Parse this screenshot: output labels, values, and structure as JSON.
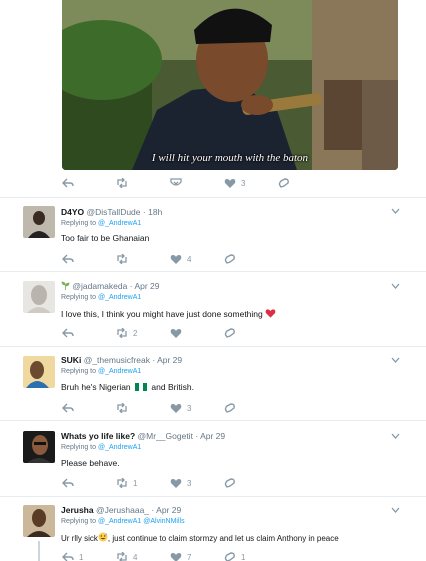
{
  "media": {
    "caption": "I will hit your mouth with the baton",
    "actions": {
      "retweets": "",
      "likes": "3",
      "reply": "",
      "mail": ""
    }
  },
  "tweets": [
    {
      "name": "D4YO",
      "handle": "@DisTallDude",
      "time": "18h",
      "replying_prefix": "Replying to",
      "replying_to": [
        "@_AndrewA1"
      ],
      "text": "Too fair to be Ghanaian",
      "counts": {
        "replies": "",
        "retweets": "",
        "likes": "4"
      }
    },
    {
      "name": "",
      "handle": "@jadamakeda",
      "time": "Apr 29",
      "replying_prefix": "Replying to",
      "replying_to": [
        "@_AndrewA1"
      ],
      "text": "I love this, I think you might have just done something",
      "counts": {
        "replies": "",
        "retweets": "2",
        "likes": ""
      }
    },
    {
      "name": "SUKi",
      "handle": "@_themusicfreak",
      "time": "Apr 29",
      "replying_prefix": "Replying to",
      "replying_to": [
        "@_AndrewA1"
      ],
      "text_before": "Bruh he's Nigerian",
      "text_after": "and British.",
      "counts": {
        "replies": "",
        "retweets": "",
        "likes": "3"
      }
    },
    {
      "name": "Whats yo life like?",
      "handle": "@Mr__Gogetit",
      "time": "Apr 29",
      "replying_prefix": "Replying to",
      "replying_to": [
        "@_AndrewA1"
      ],
      "text": "Please behave.",
      "counts": {
        "replies": "",
        "retweets": "1",
        "likes": "3"
      }
    },
    {
      "name": "Jerusha",
      "handle": "@Jerushaaa_",
      "time": "Apr 29",
      "replying_prefix": "Replying to",
      "replying_to": [
        "@_AndrewA1",
        "@AlvinNMills"
      ],
      "text_before": "Ur rlly sick",
      "text_after": ", just continue to claim stormzy and let us claim Anthony in peace",
      "counts": {
        "replies": "1",
        "retweets": "4",
        "likes": "7",
        "dm": "1"
      }
    }
  ],
  "separator": "·",
  "colors": {
    "icon": "#8899a6",
    "link": "#1da1f2",
    "heart": "#e0245e",
    "divider": "#e6ecf0",
    "flag_green": "#008751"
  }
}
